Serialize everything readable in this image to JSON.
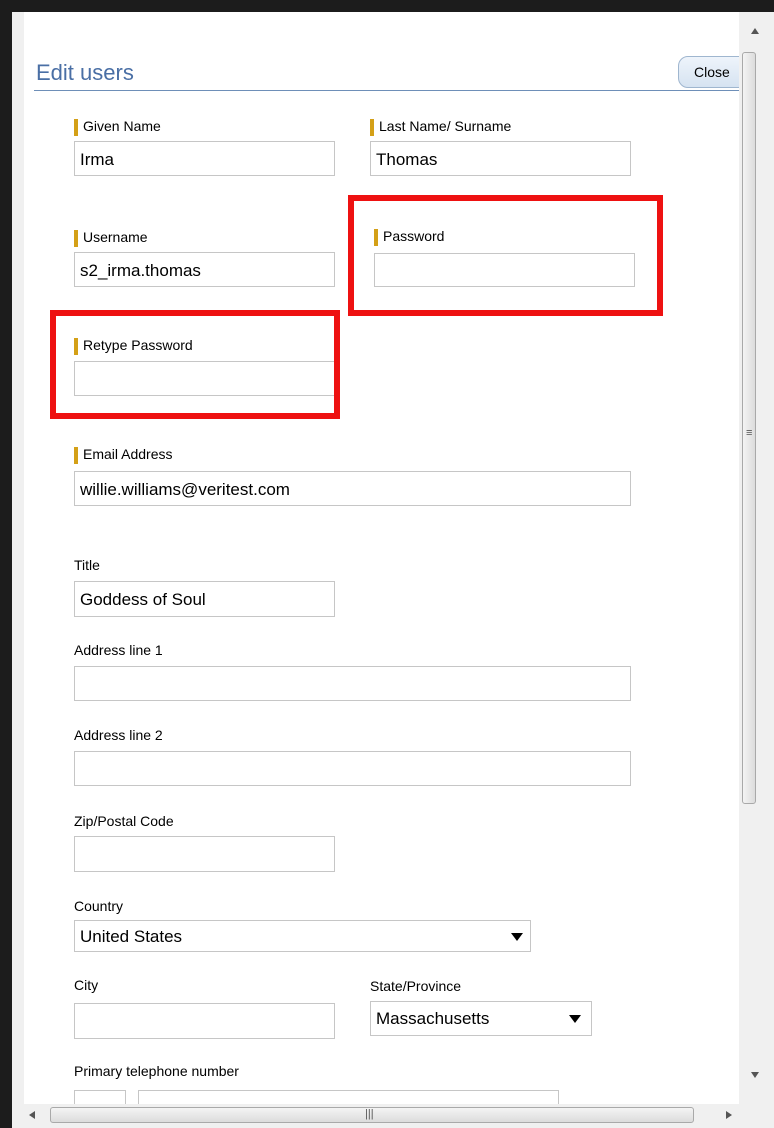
{
  "dialog": {
    "title": "Edit users",
    "close_label": "Close"
  },
  "fields": {
    "given_name": {
      "label": "Given Name",
      "value": "Irma"
    },
    "last_name": {
      "label": "Last Name/ Surname",
      "value": "Thomas"
    },
    "username": {
      "label": "Username",
      "value": "s2_irma.thomas"
    },
    "password": {
      "label": "Password",
      "value": ""
    },
    "retype_password": {
      "label": "Retype Password",
      "value": ""
    },
    "email": {
      "label": "Email Address",
      "value": "willie.williams@veritest.com"
    },
    "title": {
      "label": "Title",
      "value": "Goddess of Soul"
    },
    "address1": {
      "label": "Address line 1",
      "value": ""
    },
    "address2": {
      "label": "Address line 2",
      "value": ""
    },
    "zip": {
      "label": "Zip/Postal Code",
      "value": ""
    },
    "country": {
      "label": "Country",
      "value": "United States"
    },
    "city": {
      "label": "City",
      "value": ""
    },
    "state": {
      "label": "State/Province",
      "value": "Massachusetts"
    },
    "phone": {
      "label": "Primary telephone number",
      "value": ""
    }
  },
  "colors": {
    "required_marker": "#d4a017",
    "highlight": "#ee1111",
    "title": "#4a6fa5"
  }
}
